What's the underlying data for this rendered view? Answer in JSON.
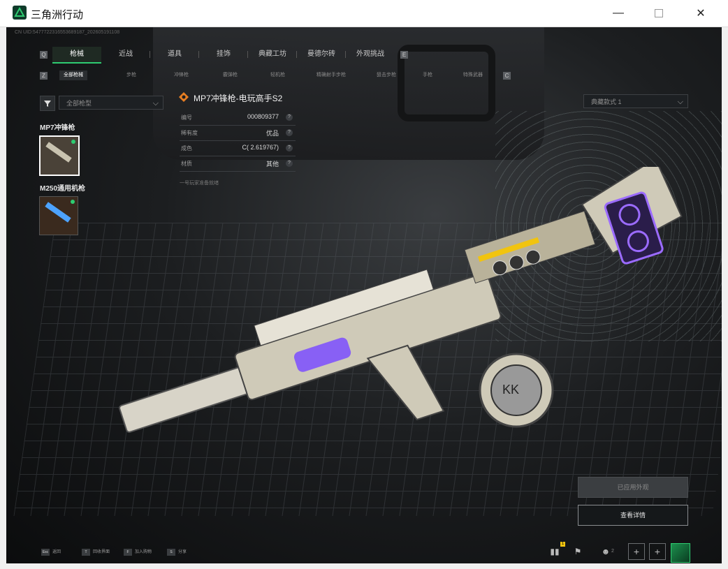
{
  "window": {
    "title": "三角洲行动",
    "minimize_glyph": "—",
    "close_glyph": "✕"
  },
  "uid": "CN UID:5477722316553689187_202605191108",
  "main_tabs": [
    {
      "label": "枪械",
      "active": true
    },
    {
      "label": "近战",
      "active": false
    },
    {
      "label": "道具",
      "active": false
    },
    {
      "label": "挂饰",
      "active": false
    },
    {
      "label": "典藏工坊",
      "active": false
    },
    {
      "label": "曼德尔砖",
      "active": false
    },
    {
      "label": "外观挑战",
      "active": false
    }
  ],
  "sub_tabs": [
    {
      "label": "全部枪械",
      "active": true
    },
    {
      "label": "步枪",
      "active": false
    },
    {
      "label": "冲锋枪",
      "active": false
    },
    {
      "label": "霰弹枪",
      "active": false
    },
    {
      "label": "轻机枪",
      "active": false
    },
    {
      "label": "精确射手步枪",
      "active": false
    },
    {
      "label": "狙击步枪",
      "active": false
    },
    {
      "label": "手枪",
      "active": false
    },
    {
      "label": "特殊武器",
      "active": false
    }
  ],
  "filter": {
    "weapon_type_select": "全部枪型",
    "collection_select": "典藏款式 1"
  },
  "weapons": [
    {
      "name": "MP7冲锋枪",
      "selected": true,
      "color": "#c9c3b0"
    },
    {
      "name": "M250通用机枪",
      "selected": false,
      "color": "#4da3ff"
    }
  ],
  "item": {
    "title": "MP7冲锋枪-电玩高手S2",
    "rows": [
      {
        "key": "编号",
        "value": "000809377"
      },
      {
        "key": "稀有度",
        "value": "优品"
      },
      {
        "key": "成色",
        "value": "C( 2.619767)"
      },
      {
        "key": "材质",
        "value": "其他"
      }
    ],
    "source": "一号玩家准备就绪"
  },
  "buttons": {
    "applied": "已应用外观",
    "view_details": "查看详情"
  },
  "hints": [
    {
      "key": "Esc",
      "label": "返回"
    },
    {
      "key": "T",
      "label": "回收界面"
    },
    {
      "key": "F",
      "label": "加入购物"
    },
    {
      "key": "S",
      "label": "分享"
    }
  ],
  "bottom_right": {
    "notification_badge": "1",
    "friends_count": "2",
    "plus_glyph": "+"
  },
  "accent_color": "#2ecc71"
}
